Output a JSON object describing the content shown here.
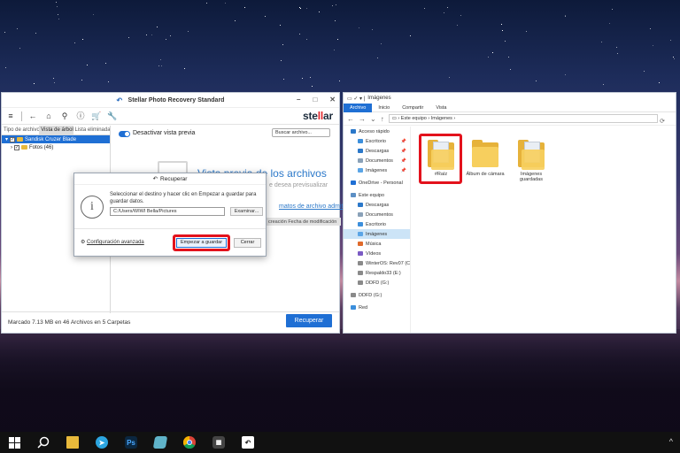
{
  "stellar": {
    "title": "Stellar Photo Recovery Standard",
    "brand_prefix": "ste",
    "brand_ll": "ll",
    "brand_suffix": "ar",
    "toolbar": {
      "menu": "≡",
      "back": "←",
      "recover": "⌂",
      "scan": "⚲",
      "info": "ⓘ",
      "cart": "🛒",
      "tools": "🔧"
    },
    "tabs": [
      "Tipo de archivo",
      "Vista de árbol",
      "Lista eliminada"
    ],
    "tree": [
      {
        "label": "Sandisk Cruzer Blade",
        "selected": true
      },
      {
        "label": "Fotos (46)",
        "selected": false
      }
    ],
    "preview_toggle_label": "Desactivar vista previa",
    "search_placeholder": "Buscar archivo...",
    "preview_title": "Vista previa de los archivos",
    "preview_sub": "e desea previsualizar",
    "formats_link": "matos de archivo admitidos",
    "column_header": "creación  Fecha de modificación",
    "status": "Marcado 7.13 MB en 46  Archivos en 5 Carpetas",
    "recover_button": "Recuperar"
  },
  "dialog": {
    "title": "Recuperar",
    "message": "Seleccionar el destino y hacer clic en Empezar a guardar para guardar datos.",
    "path": "C:/Users/WIWI Bella/Pictures",
    "browse": "Examinar...",
    "advanced": "Configuración avanzada",
    "start_save": "Empezar a guardar",
    "close": "Cerrar"
  },
  "explorer": {
    "title": "Imágenes",
    "ribbon_tabs": [
      "Archivo",
      "Inicio",
      "Compartir",
      "Vista"
    ],
    "address": "Este equipo  ›  Imágenes  ›",
    "sidebar": [
      {
        "label": "Acceso rápido",
        "level": 0,
        "color": "#2b78c9",
        "pin": false
      },
      {
        "label": "Escritorio",
        "level": 1,
        "color": "#3c8fdc",
        "pin": true
      },
      {
        "label": "Descargas",
        "level": 1,
        "color": "#2b78c9",
        "pin": true
      },
      {
        "label": "Documentos",
        "level": 1,
        "color": "#8aa1b8",
        "pin": true
      },
      {
        "label": "Imágenes",
        "level": 1,
        "color": "#5ba5e6",
        "pin": true
      },
      {
        "label": "OneDrive - Personal",
        "level": 0,
        "color": "#1f6fd4",
        "pin": false
      },
      {
        "label": "Este equipo",
        "level": 0,
        "color": "#5c8fc4",
        "pin": false
      },
      {
        "label": "Descargas",
        "level": 1,
        "color": "#2b78c9",
        "pin": false
      },
      {
        "label": "Documentos",
        "level": 1,
        "color": "#8aa1b8",
        "pin": false
      },
      {
        "label": "Escritorio",
        "level": 1,
        "color": "#3c8fdc",
        "pin": false
      },
      {
        "label": "Imágenes",
        "level": 1,
        "color": "#5ba5e6",
        "pin": false,
        "selected": true
      },
      {
        "label": "Música",
        "level": 1,
        "color": "#e06a2b",
        "pin": false
      },
      {
        "label": "Vídeos",
        "level": 1,
        "color": "#7b5bc4",
        "pin": false
      },
      {
        "label": "WinterOS: Rev07  (C",
        "level": 1,
        "color": "#8a8a8a",
        "pin": false
      },
      {
        "label": "Respaldo33 (E:)",
        "level": 1,
        "color": "#8a8a8a",
        "pin": false
      },
      {
        "label": "DDFD (G:)",
        "level": 1,
        "color": "#8a8a8a",
        "pin": false
      },
      {
        "label": "DDFD (G:)",
        "level": 0,
        "color": "#8a8a8a",
        "pin": false
      },
      {
        "label": "Red",
        "level": 0,
        "color": "#3c8fdc",
        "pin": false
      }
    ],
    "folders": [
      {
        "label": "#Raíz",
        "highlighted": true
      },
      {
        "label": "Álbum de cámara",
        "highlighted": false
      },
      {
        "label": "Imágenes guardadas",
        "highlighted": false
      }
    ]
  },
  "taskbar": {
    "start": "start-icon",
    "items": [
      "search-icon",
      "file-explorer-icon",
      "telegram-icon",
      "photoshop-icon",
      "notepad-icon",
      "chrome-icon",
      "calculator-icon",
      "stellar-app-icon"
    ],
    "ps_label": "Ps",
    "tray_chevron": "^"
  }
}
